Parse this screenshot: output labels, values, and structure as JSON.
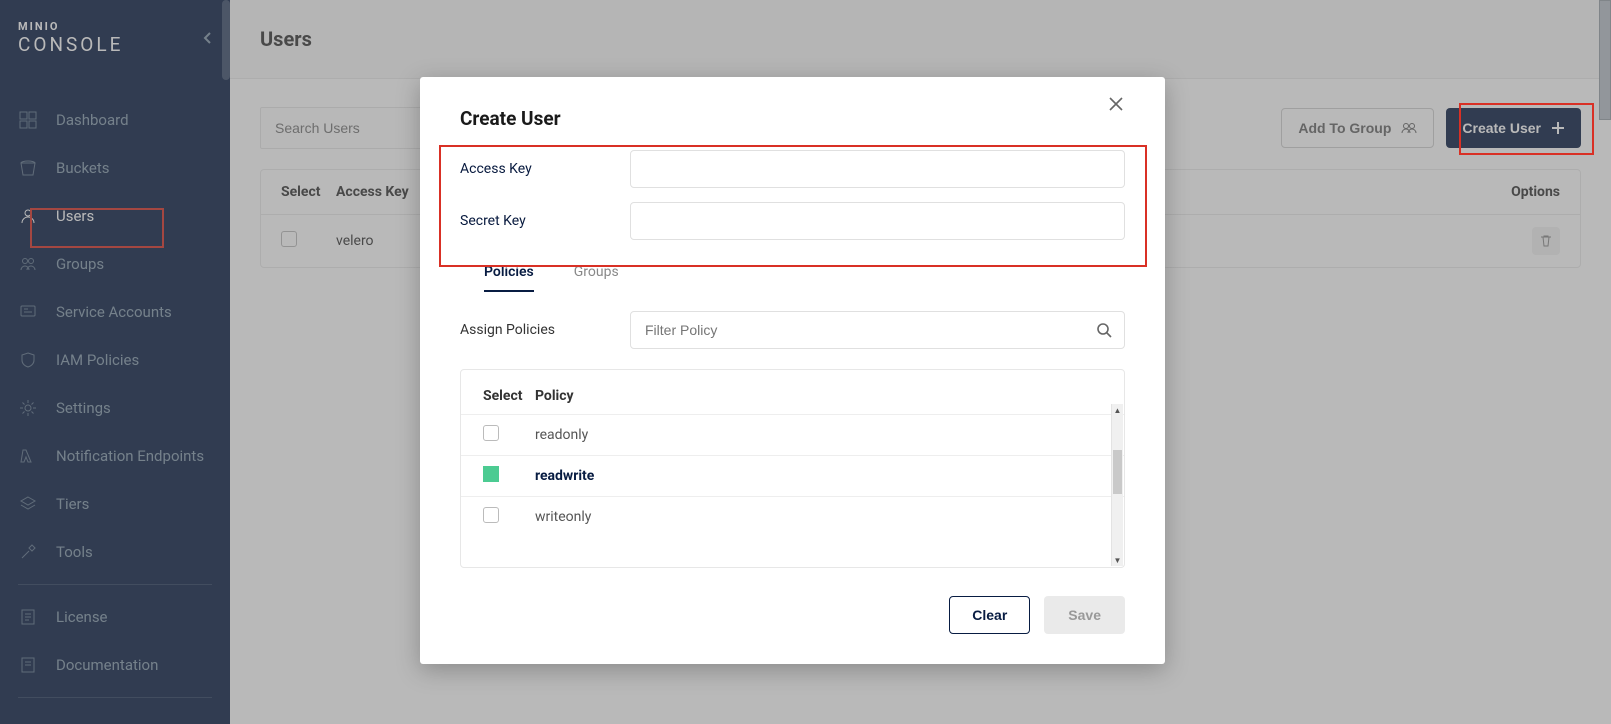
{
  "logo": {
    "brand": "MINIO",
    "product": "CONSOLE"
  },
  "sidebar": {
    "items": [
      {
        "label": "Dashboard",
        "icon": "dashboard-icon"
      },
      {
        "label": "Buckets",
        "icon": "bucket-icon"
      },
      {
        "label": "Users",
        "icon": "user-icon",
        "active": true
      },
      {
        "label": "Groups",
        "icon": "groups-icon"
      },
      {
        "label": "Service Accounts",
        "icon": "service-accounts-icon"
      },
      {
        "label": "IAM Policies",
        "icon": "shield-icon"
      },
      {
        "label": "Settings",
        "icon": "gear-icon"
      },
      {
        "label": "Notification Endpoints",
        "icon": "lambda-icon"
      },
      {
        "label": "Tiers",
        "icon": "layers-icon"
      },
      {
        "label": "Tools",
        "icon": "tools-icon"
      }
    ],
    "secondary": [
      {
        "label": "License",
        "icon": "license-icon"
      },
      {
        "label": "Documentation",
        "icon": "docs-icon"
      }
    ]
  },
  "page": {
    "title": "Users",
    "search_placeholder": "Search Users",
    "add_to_group_label": "Add To Group",
    "create_user_label": "Create User",
    "table": {
      "cols": {
        "select": "Select",
        "access_key": "Access Key",
        "options": "Options"
      },
      "rows": [
        {
          "access_key": "velero"
        }
      ]
    }
  },
  "modal": {
    "title": "Create User",
    "access_key_label": "Access Key",
    "secret_key_label": "Secret Key",
    "access_key_value": "",
    "secret_key_value": "",
    "tabs": {
      "policies": "Policies",
      "groups": "Groups"
    },
    "assign_label": "Assign Policies",
    "filter_placeholder": "Filter Policy",
    "policy_table": {
      "cols": {
        "select": "Select",
        "policy": "Policy"
      },
      "rows": [
        {
          "name": "readonly",
          "selected": false
        },
        {
          "name": "readwrite",
          "selected": true
        },
        {
          "name": "writeonly",
          "selected": false
        }
      ]
    },
    "buttons": {
      "clear": "Clear",
      "save": "Save"
    }
  }
}
